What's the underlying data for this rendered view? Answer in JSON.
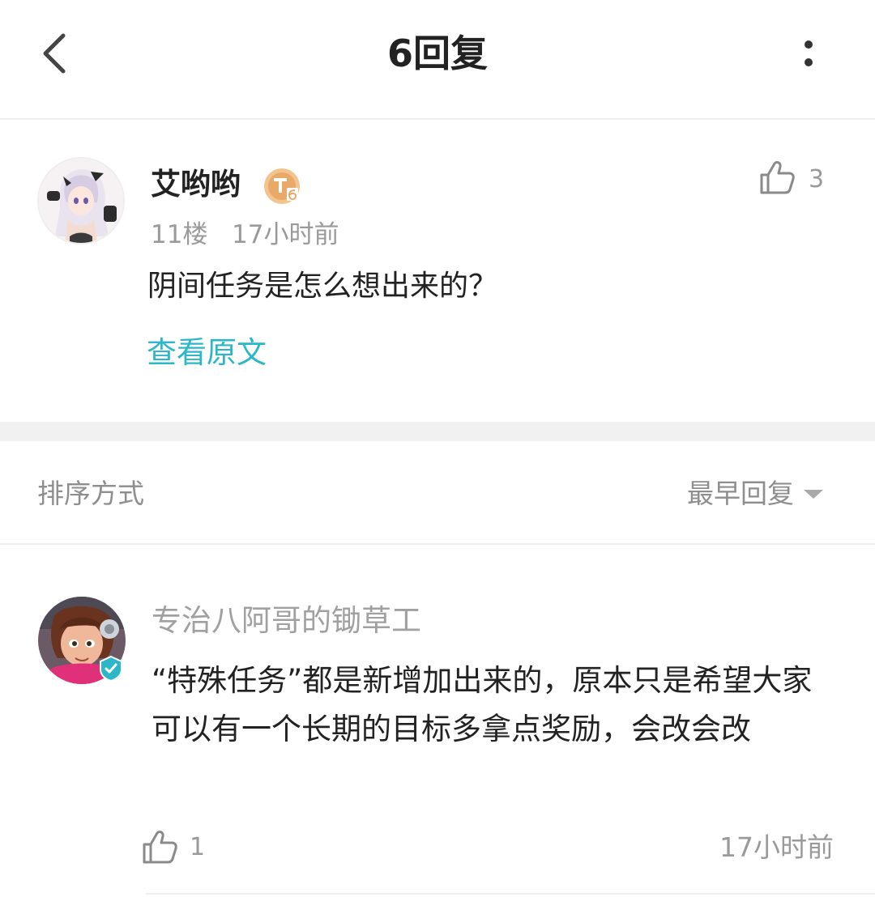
{
  "header": {
    "title": "6回复",
    "back_icon": "chevron-left-icon",
    "more_icon": "more-vertical-icon"
  },
  "post": {
    "author": "艾哟哟",
    "level_badge": "T6",
    "likes": "3",
    "floor": "11楼",
    "time": "17小时前",
    "text": "阴间任务是怎么想出来的？",
    "view_original": "查看原文"
  },
  "sort": {
    "label": "排序方式",
    "value": "最早回复"
  },
  "reply": {
    "author": "专治八阿哥的锄草工",
    "text": "“特殊任务”都是新增加出来的，原本只是希望大家可以有一个长期的目标多拿点奖励，会改会改",
    "likes": "1",
    "time": "17小时前"
  },
  "colors": {
    "accent": "#2cb7c9",
    "muted_text": "#9a9a9a",
    "divider": "#eeeeee",
    "section_gap": "#f1f1f1"
  }
}
